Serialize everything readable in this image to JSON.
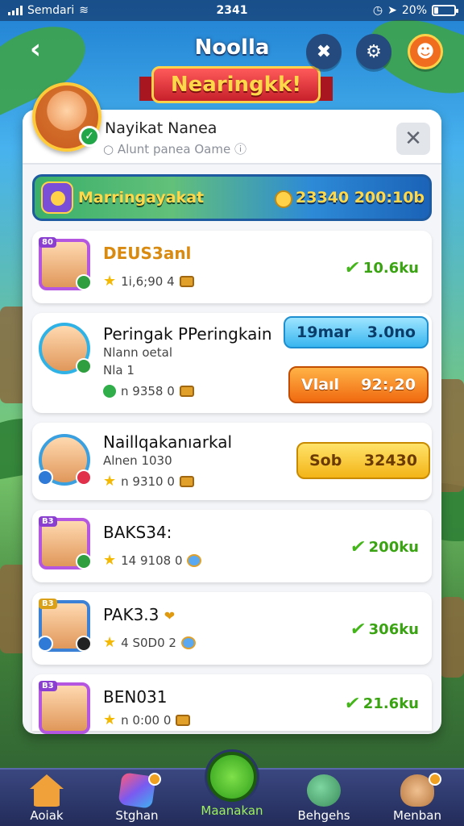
{
  "status_bar": {
    "carrier": "Semdari",
    "time": "2341",
    "battery": "20%"
  },
  "header": {
    "title": "Noolla",
    "ribbon": "Nearingkk!"
  },
  "player": {
    "name": "Nayikat Nanea",
    "subtitle": "Alunt panea Oame"
  },
  "banner": {
    "title": "Marringayakat",
    "stats": "23340 200:10b"
  },
  "rows": [
    {
      "name": "DEUS3anl",
      "meta": "1i,6;90 4",
      "score": "10.6ku",
      "tag": "80"
    },
    {
      "name": "Peringak PPeringkain",
      "line2": "Nlann oetal",
      "line3": "Nla  1",
      "meta": "n 9358 0",
      "pill_top_left": "19mar",
      "pill_top_right": "3.0no",
      "pill_bottom_left": "Vlaıl",
      "pill_bottom_right": "92:,20"
    },
    {
      "name": "Naillqakanıarkal",
      "line2": "Alnen 1030",
      "meta": "n 9310 0",
      "pill_left": "Sob",
      "pill_right": "32430"
    },
    {
      "name": "BAKS34:",
      "meta": "14 9108 0",
      "score": "200ku",
      "tag": "B3"
    },
    {
      "name": "PAK3.3",
      "meta": "4 S0D0 2",
      "score": "306ku",
      "tag": "B3"
    },
    {
      "name": "BEN031",
      "meta": "n 0:00 0",
      "score": "21.6ku",
      "tag": "B3"
    }
  ],
  "nav": [
    {
      "label": "Aoiak"
    },
    {
      "label": "Stghan"
    },
    {
      "label": "Maanakan"
    },
    {
      "label": "Behgehs"
    },
    {
      "label": "Menban"
    }
  ],
  "colors": {
    "accent_green": "#3aa312",
    "ribbon_red": "#c7202b",
    "panel_bg": "#f3f5f8",
    "nav_bg": "#232c5a"
  }
}
